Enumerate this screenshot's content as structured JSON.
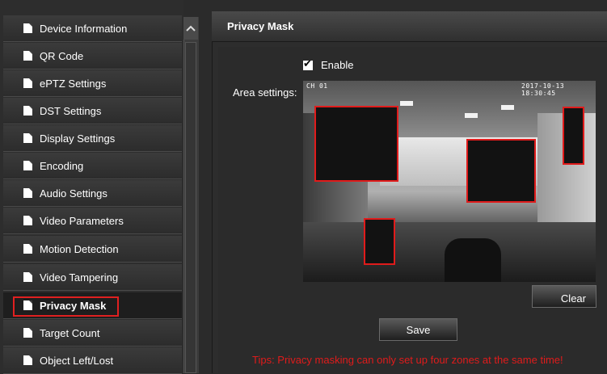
{
  "sidebar": {
    "items": [
      {
        "label": "Device Information",
        "active": false
      },
      {
        "label": "QR Code",
        "active": false
      },
      {
        "label": "ePTZ Settings",
        "active": false
      },
      {
        "label": "DST Settings",
        "active": false
      },
      {
        "label": "Display Settings",
        "active": false
      },
      {
        "label": "Encoding",
        "active": false
      },
      {
        "label": "Audio Settings",
        "active": false
      },
      {
        "label": "Video Parameters",
        "active": false
      },
      {
        "label": "Motion Detection",
        "active": false
      },
      {
        "label": "Video Tampering",
        "active": false
      },
      {
        "label": "Privacy Mask",
        "active": true
      },
      {
        "label": "Target Count",
        "active": false
      },
      {
        "label": "Object Left/Lost",
        "active": false
      }
    ],
    "item_icon": "document-icon",
    "scroll_up_icon": "chevron-up-icon"
  },
  "panel": {
    "title": "Privacy Mask",
    "enable": {
      "label": "Enable",
      "checked": true
    },
    "area_label": "Area settings:",
    "camera": {
      "osd_channel": "CH 01",
      "osd_timestamp": "2017-10-13 18:30:45",
      "mask_count": 4
    },
    "clear_label": "Clear",
    "save_label": "Save",
    "tips": "Tips: Privacy masking can only set up four zones at the same time!"
  },
  "colors": {
    "mask_border": "#e01b1b",
    "active_outline": "#e02020",
    "tips_text": "#e01b1b",
    "background": "#2b2b2b"
  }
}
